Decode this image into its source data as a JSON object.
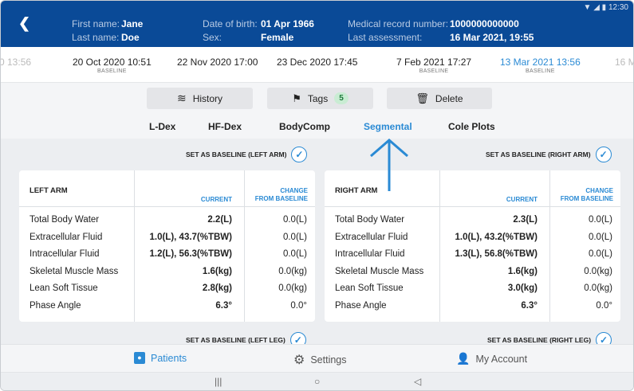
{
  "header": {
    "back_icon": "arrow-left-icon",
    "first_name_label": "First name:",
    "first_name": "Jane",
    "last_name_label": "Last name:",
    "last_name": "Doe",
    "dob_label": "Date of birth:",
    "dob": "01 Apr 1966",
    "sex_label": "Sex:",
    "sex": "Female",
    "mrn_label": "Medical record number:",
    "mrn": "1000000000000",
    "last_assessment_label": "Last assessment:",
    "last_assessment": "16 Mar 2021, 19:55",
    "status_time": "12:30"
  },
  "timeline": [
    {
      "date": "0 13:56",
      "baseline": ""
    },
    {
      "date": "20 Oct 2020 10:51",
      "baseline": "BASELINE"
    },
    {
      "date": "22 Nov 2020 17:00",
      "baseline": ""
    },
    {
      "date": "23 Dec 2020 17:45",
      "baseline": ""
    },
    {
      "date": "7 Feb 2021 17:27",
      "baseline": "BASELINE"
    },
    {
      "date": "13 Mar 2021 13:56",
      "baseline": "BASELINE"
    },
    {
      "date": "16 M",
      "baseline": ""
    }
  ],
  "actions": {
    "history": "History",
    "tags": "Tags",
    "tags_count": "5",
    "delete": "Delete"
  },
  "tabs": [
    "L-Dex",
    "HF-Dex",
    "BodyComp",
    "Segmental",
    "Cole Plots"
  ],
  "baseline_labels": {
    "left_arm": "SET AS BASELINE (LEFT ARM)",
    "right_arm": "SET AS BASELINE (RIGHT ARM)",
    "left_leg": "SET AS BASELINE (LEFT LEG)",
    "right_leg": "SET AS BASELINE (RIGHT LEG)"
  },
  "columns": {
    "current": "CURRENT",
    "change_line1": "CHANGE",
    "change_line2": "FROM BASELINE"
  },
  "left_arm": {
    "title": "LEFT ARM",
    "rows": [
      {
        "name": "Total Body Water",
        "current": "2.2(L)",
        "change": "0.0(L)"
      },
      {
        "name": "Extracellular Fluid",
        "current": "1.0(L), 43.7(%TBW)",
        "change": "0.0(L)"
      },
      {
        "name": "Intracellular Fluid",
        "current": "1.2(L), 56.3(%TBW)",
        "change": "0.0(L)"
      },
      {
        "name": "Skeletal Muscle Mass",
        "current": "1.6(kg)",
        "change": "0.0(kg)"
      },
      {
        "name": "Lean Soft Tissue",
        "current": "2.8(kg)",
        "change": "0.0(kg)"
      },
      {
        "name": "Phase Angle",
        "current": "6.3°",
        "change": "0.0°"
      }
    ]
  },
  "right_arm": {
    "title": "RIGHT ARM",
    "rows": [
      {
        "name": "Total Body Water",
        "current": "2.3(L)",
        "change": "0.0(L)"
      },
      {
        "name": "Extracellular Fluid",
        "current": "1.0(L), 43.2(%TBW)",
        "change": "0.0(L)"
      },
      {
        "name": "Intracellular Fluid",
        "current": "1.3(L), 56.8(%TBW)",
        "change": "0.0(L)"
      },
      {
        "name": "Skeletal Muscle Mass",
        "current": "1.6(kg)",
        "change": "0.0(kg)"
      },
      {
        "name": "Lean Soft Tissue",
        "current": "3.0(kg)",
        "change": "0.0(kg)"
      },
      {
        "name": "Phase Angle",
        "current": "6.3°",
        "change": "0.0°"
      }
    ]
  },
  "nav": {
    "patients": "Patients",
    "settings": "Settings",
    "account": "My Account"
  },
  "system_nav": {
    "recents": "|||",
    "home": "○",
    "back": "◁"
  },
  "colors": {
    "header": "#0a4a97",
    "accent": "#2a8ad4",
    "badge_bg": "#c9ecd3"
  }
}
